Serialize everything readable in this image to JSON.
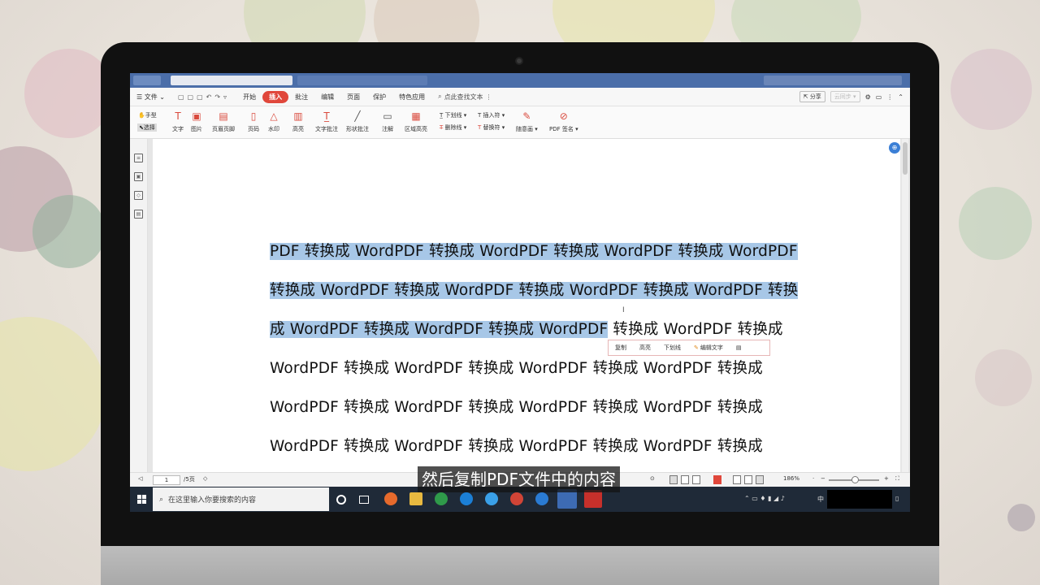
{
  "menu": {
    "file": "文件",
    "tabs": [
      "开始",
      "插入",
      "批注",
      "编辑",
      "页面",
      "保护",
      "特色应用"
    ],
    "active_tab": "插入",
    "search_hint": "点此查找文本",
    "share": "分享",
    "cloud": "云同步"
  },
  "ribbon": {
    "hand": "手型",
    "select": "选择",
    "items": [
      "文字",
      "图片",
      "页眉页脚",
      "页码",
      "水印",
      "高亮",
      "文字批注",
      "形状批注",
      "注解",
      "区域高亮"
    ],
    "underline": "下划线",
    "strikethrough": "删除线",
    "insert_symbol": "插入符",
    "replace_symbol": "替换符",
    "freehand": "随意画",
    "pdf_sign": "PDF 签名"
  },
  "document": {
    "lines": [
      {
        "highlighted": "PDF 转换成 WordPDF 转换成 WordPDF 转换成 WordPDF 转换成 WordPDF",
        "rest": ""
      },
      {
        "highlighted": "转换成 WordPDF 转换成 WordPDF 转换成 WordPDF 转换成 WordPDF 转换",
        "rest": ""
      },
      {
        "highlighted": "成 WordPDF 转换成 WordPDF 转换成 WordPDF",
        "rest": " 转换成 WordPDF 转换成"
      },
      {
        "highlighted": "",
        "rest": "WordPDF 转换成 WordPDF 转换成 WordPDF 转换成 WordPDF 转换成"
      },
      {
        "highlighted": "",
        "rest": "WordPDF 转换成 WordPDF 转换成 WordPDF 转换成 WordPDF 转换成"
      },
      {
        "highlighted": "",
        "rest": "WordPDF 转换成 WordPDF 转换成 WordPDF 转换成 WordPDF 转换成"
      }
    ]
  },
  "mini_toolbar": {
    "copy": "复制",
    "highlight": "高亮",
    "underline": "下划线",
    "edit_text": "编辑文字"
  },
  "statusbar": {
    "page_current": "1",
    "page_total": "/5页",
    "zoom": "186%"
  },
  "taskbar": {
    "search_placeholder": "在这里输入你要搜索的内容",
    "input_method": "中"
  },
  "subtitle": "然后复制PDF文件中的内容",
  "colors": {
    "selection": "#a7c7e7",
    "accent": "#e0473b",
    "tab_bar": "#4b6ea9",
    "taskbar": "#1f2a38"
  }
}
